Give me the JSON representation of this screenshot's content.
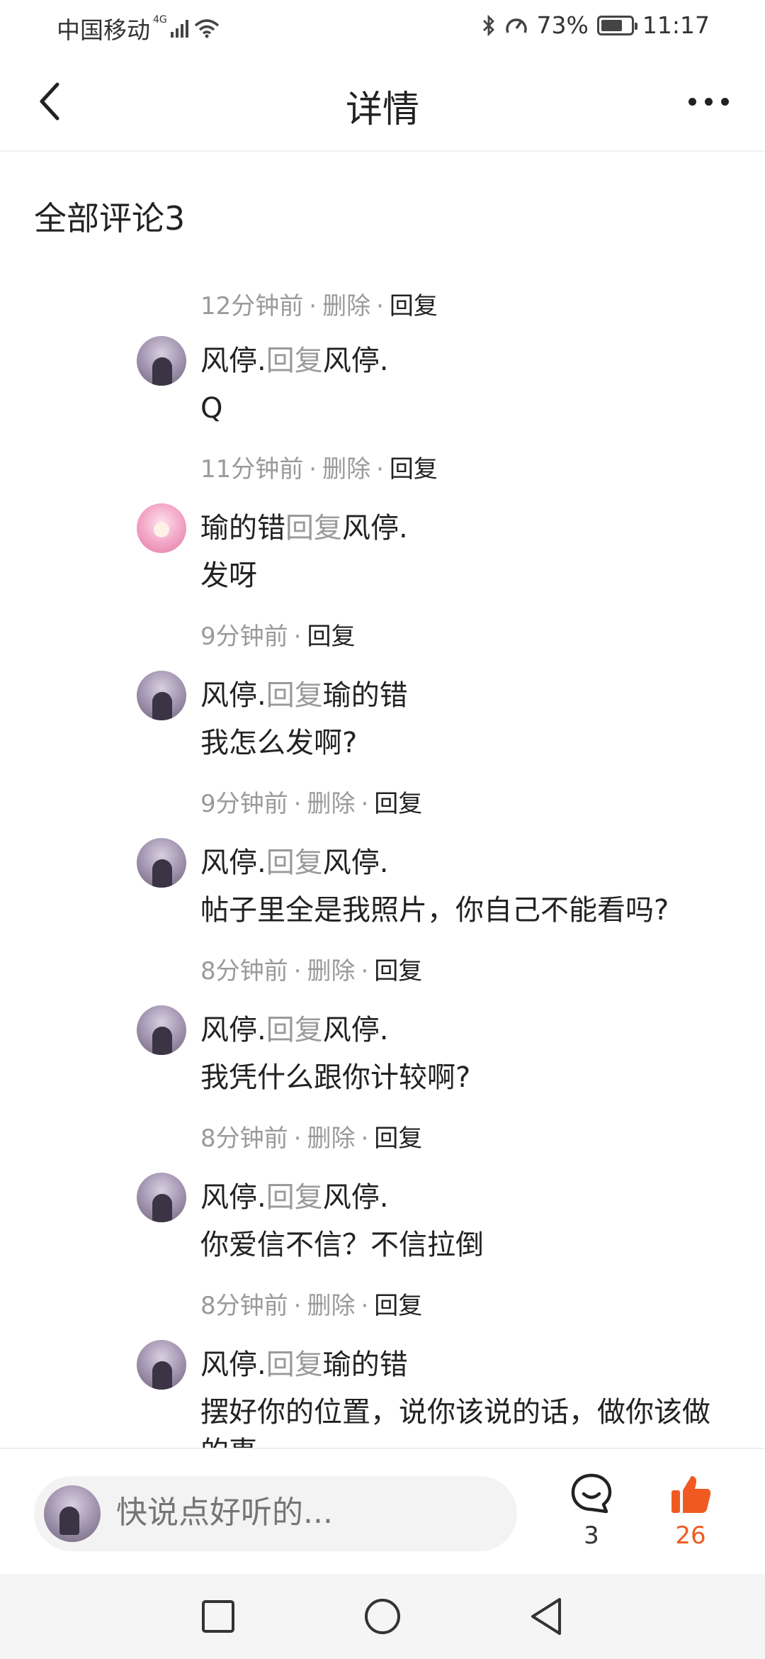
{
  "status_bar": {
    "carrier": "中国移动",
    "network": "4G",
    "battery": "73%",
    "battery_level": 0.73,
    "time": "11:17"
  },
  "nav": {
    "title": "详情"
  },
  "section": {
    "title": "全部评论3"
  },
  "thread": {
    "top_meta": {
      "time": "12分钟前",
      "delete": "删除",
      "reply": "回复"
    },
    "comments": [
      {
        "author": "风停.",
        "reply_word": "回复",
        "target": "风停.",
        "text": "Q",
        "time": "11分钟前",
        "delete": "删除",
        "reply": "回复",
        "avatar": "purple"
      },
      {
        "author": "瑜的错",
        "reply_word": "回复",
        "target": "风停.",
        "text": "发呀",
        "time": "9分钟前",
        "delete": "",
        "reply": "回复",
        "avatar": "pink"
      },
      {
        "author": "风停.",
        "reply_word": "回复",
        "target": "瑜的错",
        "text": "我怎么发啊?",
        "time": "9分钟前",
        "delete": "删除",
        "reply": "回复",
        "avatar": "purple"
      },
      {
        "author": "风停.",
        "reply_word": "回复",
        "target": "风停.",
        "text": "帖子里全是我照片，你自己不能看吗?",
        "time": "8分钟前",
        "delete": "删除",
        "reply": "回复",
        "avatar": "purple"
      },
      {
        "author": "风停.",
        "reply_word": "回复",
        "target": "风停.",
        "text": "我凭什么跟你计较啊?",
        "time": "8分钟前",
        "delete": "删除",
        "reply": "回复",
        "avatar": "purple"
      },
      {
        "author": "风停.",
        "reply_word": "回复",
        "target": "风停.",
        "text": "你爱信不信？不信拉倒",
        "time": "8分钟前",
        "delete": "删除",
        "reply": "回复",
        "avatar": "purple"
      },
      {
        "author": "风停.",
        "reply_word": "回复",
        "target": "瑜的错",
        "text": "摆好你的位置，说你该说的话，做你该做的事",
        "time": "",
        "delete": "",
        "reply": "",
        "avatar": "purple"
      }
    ]
  },
  "bottom_bar": {
    "input_placeholder": "快说点好听的...",
    "comment_count": "3",
    "like_count": "26",
    "like_color": "#f05a22"
  },
  "system_nav": {
    "icons": [
      "recent-apps-icon",
      "home-icon",
      "back-icon"
    ]
  }
}
